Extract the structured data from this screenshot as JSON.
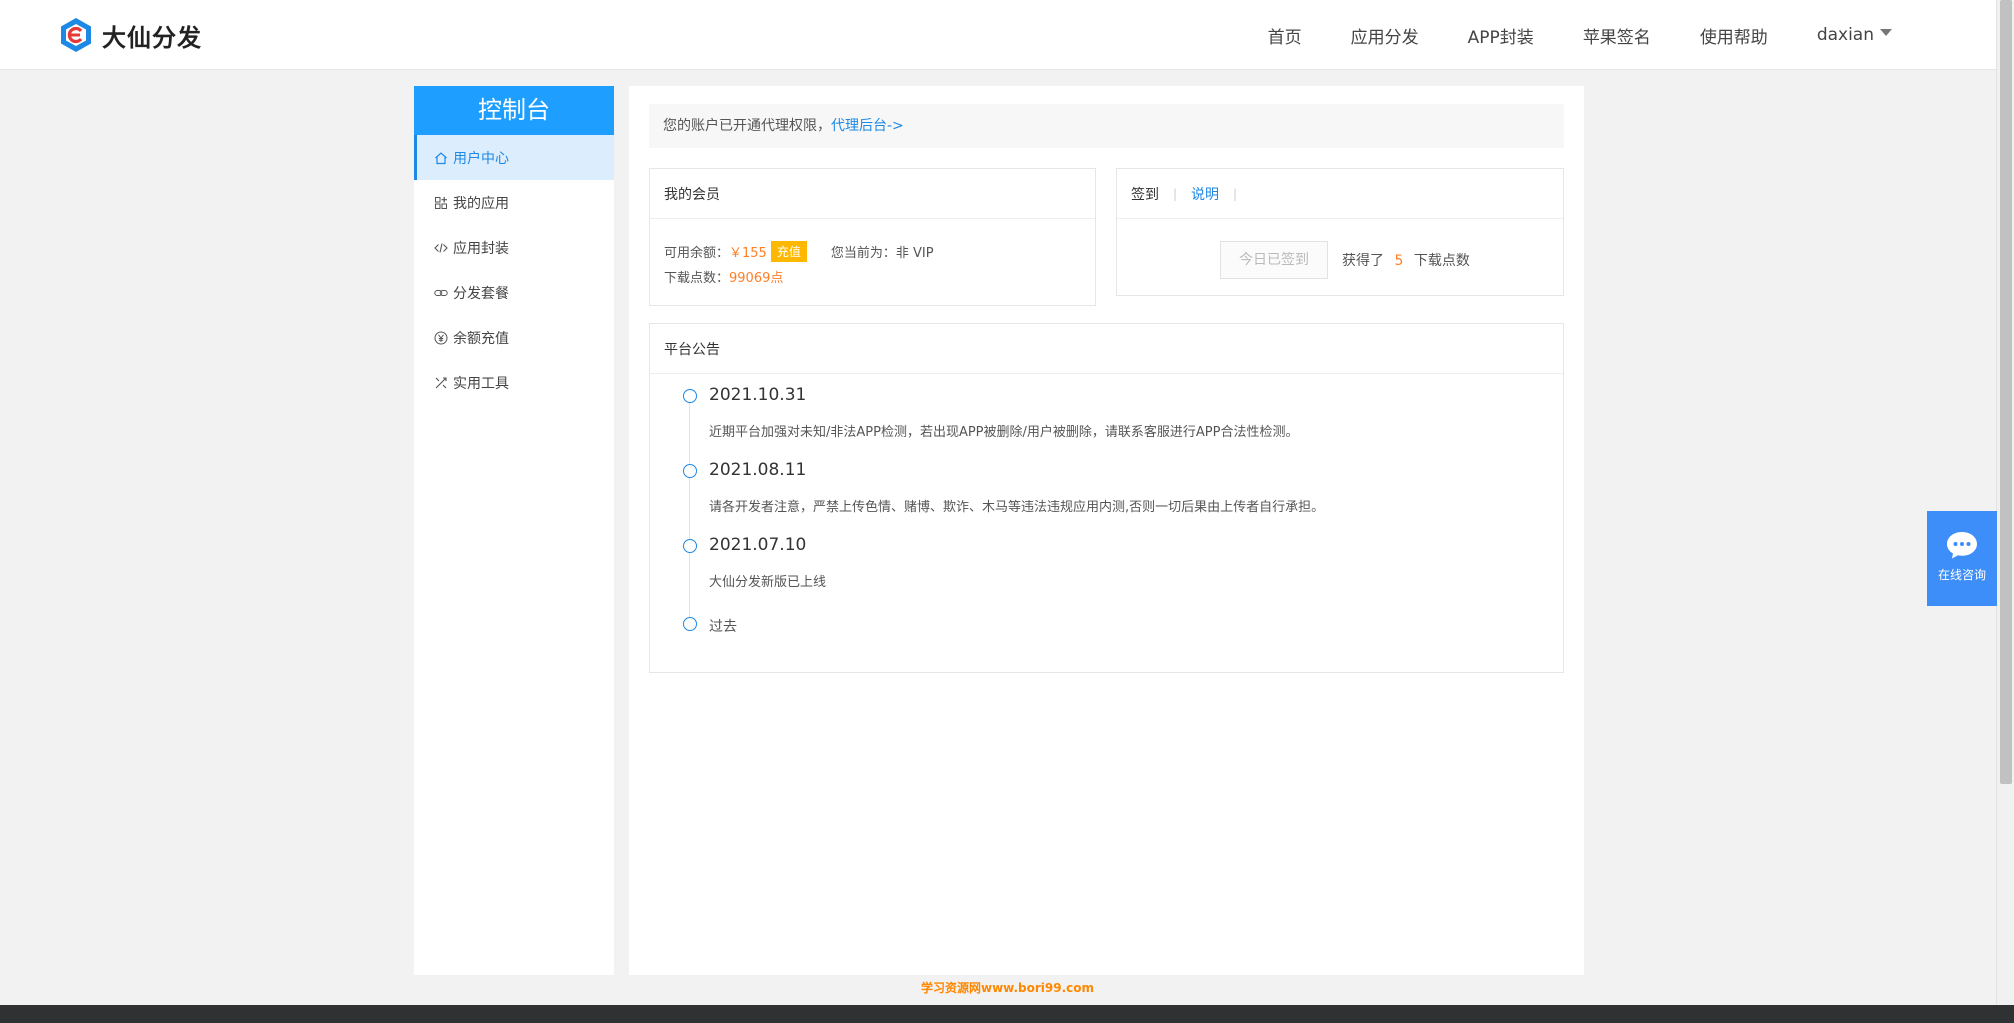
{
  "header": {
    "brand": "大仙分发",
    "nav": [
      "首页",
      "应用分发",
      "APP封装",
      "苹果签名",
      "使用帮助"
    ],
    "user": "daxian"
  },
  "sidebar": {
    "title": "控制台",
    "items": [
      {
        "label": "用户中心",
        "icon": "home-icon",
        "active": true
      },
      {
        "label": "我的应用",
        "icon": "apps-icon"
      },
      {
        "label": "应用封装",
        "icon": "code-icon"
      },
      {
        "label": "分发套餐",
        "icon": "link-icon"
      },
      {
        "label": "余额充值",
        "icon": "yen-icon"
      },
      {
        "label": "实用工具",
        "icon": "tools-icon"
      }
    ]
  },
  "notice": {
    "text": "您的账户已开通代理权限，",
    "link": "代理后台->"
  },
  "member": {
    "title": "我的会员",
    "balance_label": "可用余额：",
    "balance_value": "￥155",
    "recharge": "充值",
    "vip_text": "您当前为：非 VIP",
    "points_label": "下载点数：",
    "points_value": "99069点"
  },
  "signin": {
    "tab": "签到",
    "explain": "说明",
    "signed_button": "今日已签到",
    "earned_prefix": "获得了",
    "earned_value": "5",
    "earned_suffix": "下载点数"
  },
  "announce": {
    "title": "平台公告",
    "items": [
      {
        "date": "2021.10.31",
        "text": "近期平台加强对未知/非法APP检测，若出现APP被删除/用户被删除，请联系客服进行APP合法性检测。"
      },
      {
        "date": "2021.08.11",
        "text": "请各开发者注意，严禁上传色情、赌博、欺诈、木马等违法违规应用内测,否则一切后果由上传者自行承担。"
      },
      {
        "date": "2021.07.10",
        "text": "大仙分发新版已上线"
      }
    ],
    "past": "过去"
  },
  "chat": {
    "label": "在线咨询"
  },
  "watermark": "学习资源网www.bori99.com",
  "colors": {
    "primary": "#1e9fff",
    "accent": "#ff7f27",
    "badge": "#ffb800",
    "link": "#1e88e5"
  }
}
